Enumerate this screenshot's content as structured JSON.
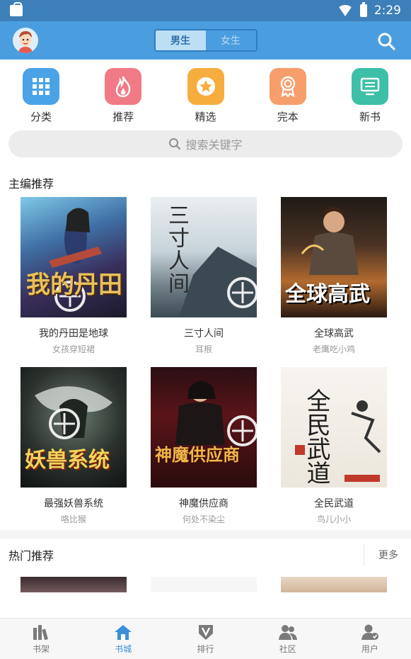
{
  "status_bar": {
    "time": "2:29"
  },
  "header": {
    "tabs": [
      {
        "label": "男生",
        "active": true
      },
      {
        "label": "女生",
        "active": false
      }
    ],
    "accent": "#4a9ee0"
  },
  "categories": [
    {
      "label": "分类",
      "icon": "grid-icon",
      "color": "#4aa3e6"
    },
    {
      "label": "推荐",
      "icon": "flame-icon",
      "color": "#f07b86"
    },
    {
      "label": "精选",
      "icon": "star-icon",
      "color": "#f6ad3e"
    },
    {
      "label": "完本",
      "icon": "award-icon",
      "color": "#f79e6b"
    },
    {
      "label": "新书",
      "icon": "monitor-icon",
      "color": "#3dbfa8"
    }
  ],
  "search": {
    "placeholder": "搜索关键字"
  },
  "editor_picks": {
    "title": "主编推荐",
    "books": [
      {
        "title": "我的丹田是地球",
        "author": "女孩穿短裙",
        "cover_text": "我的丹田"
      },
      {
        "title": "三寸人间",
        "author": "耳根",
        "cover_text": "三寸人间"
      },
      {
        "title": "全球高武",
        "author": "老鹰吃小鸡",
        "cover_text": "全球高武"
      },
      {
        "title": "最强妖兽系统",
        "author": "咯比猴",
        "cover_text": "妖兽系统"
      },
      {
        "title": "神魔供应商",
        "author": "何处不染尘",
        "cover_text": "神魔供应商"
      },
      {
        "title": "全民武道",
        "author": "鸟儿小小",
        "cover_text": "全民武道"
      }
    ]
  },
  "hot": {
    "title": "热门推荐",
    "more_label": "更多"
  },
  "bottom_nav": [
    {
      "label": "书架",
      "icon": "bookshelf-icon",
      "active": false
    },
    {
      "label": "书城",
      "icon": "home-icon",
      "active": true
    },
    {
      "label": "排行",
      "icon": "ranking-icon",
      "active": false
    },
    {
      "label": "社区",
      "icon": "community-icon",
      "active": false
    },
    {
      "label": "用户",
      "icon": "user-icon",
      "active": false
    }
  ]
}
